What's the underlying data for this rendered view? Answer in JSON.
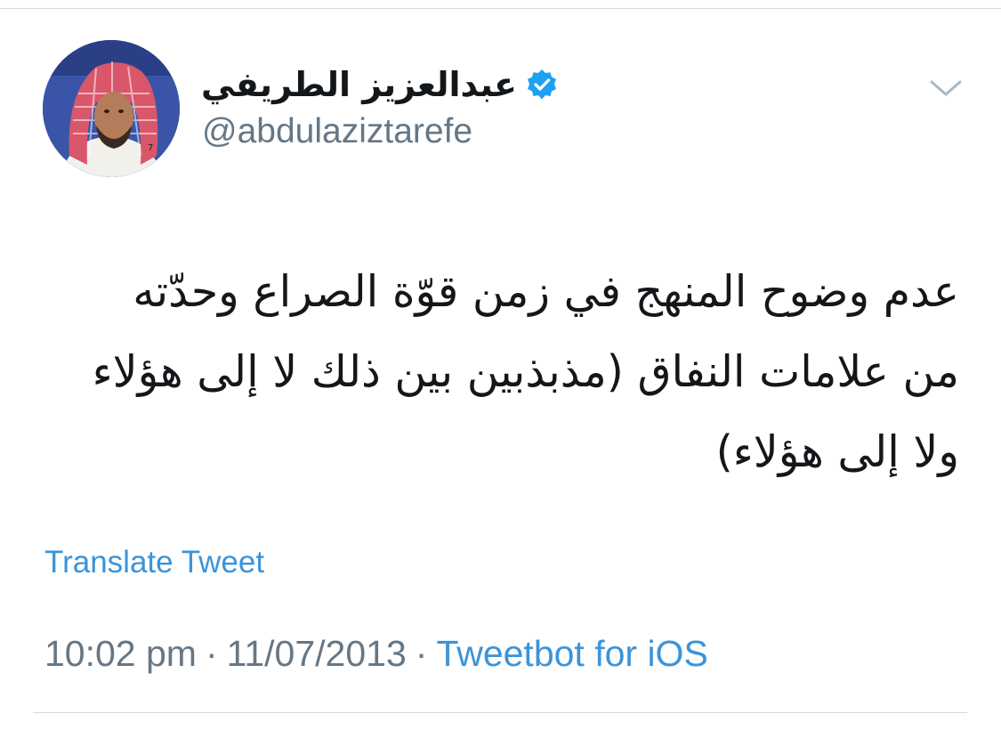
{
  "tweet": {
    "author": {
      "display_name": "عبدالعزيز الطريفي",
      "handle": "@abdulaziztarefe",
      "verified": true
    },
    "text_lines": [
      "عدم وضوح المنهج في زمن قوّة الصراع وحدّته",
      "من علامات النفاق (مذبذبين بين ذلك لا إلى هؤلاء",
      "ولا إلى هؤلاء)"
    ],
    "translate_label": "Translate Tweet",
    "time": "10:02 pm",
    "date": "11/07/2013",
    "separator": "·",
    "source": "Tweetbot for iOS"
  },
  "icons": {
    "verified": "verified-badge-icon",
    "chevron": "chevron-down-icon",
    "avatar": "profile-photo"
  },
  "colors": {
    "link_blue": "#3b94d9",
    "verified_blue": "#1da1f2",
    "secondary_text": "#657786",
    "primary_text": "#14171a"
  }
}
